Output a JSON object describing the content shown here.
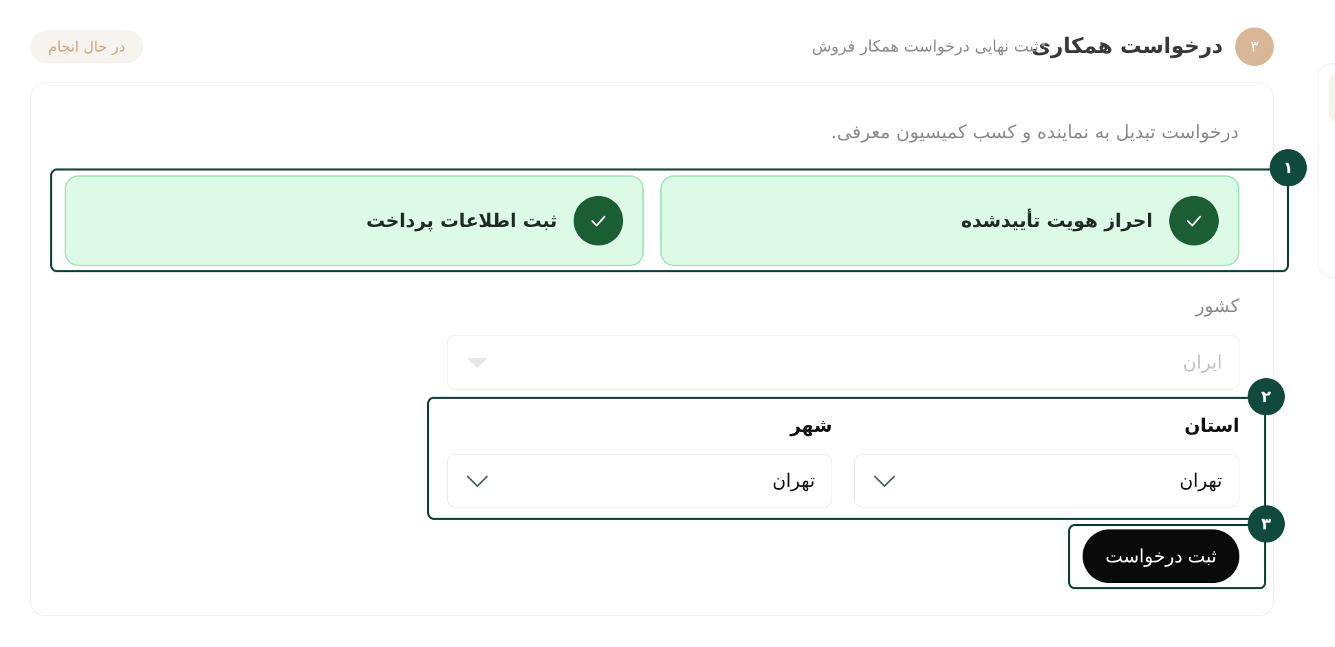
{
  "header": {
    "step_number": "۳",
    "title": "درخواست همکاری",
    "subtitle": "ثبت نهایی درخواست همکار فروش",
    "status": "در حال انجام"
  },
  "intro_text": "درخواست تبدیل به نماینده و کسب کمیسیون معرفی.",
  "annotations": {
    "badge_1": "۱",
    "badge_2": "۲",
    "badge_3": "۳"
  },
  "requirements": [
    {
      "label": "احراز هویت تأییدشده",
      "icon": "check-icon",
      "status": "done"
    },
    {
      "label": "ثبت اطلاعات پرداخت",
      "icon": "check-icon",
      "status": "done"
    }
  ],
  "form": {
    "country": {
      "label": "کشور",
      "value": "ایران",
      "disabled": true
    },
    "province": {
      "label": "استان",
      "value": "تهران"
    },
    "city": {
      "label": "شهر",
      "value": "تهران"
    },
    "submit_label": "ثبت درخواست"
  },
  "colors": {
    "accent_dark_green": "#0f4a3c",
    "success_bg": "#dcfae6",
    "success_border": "#9ae6b4",
    "check_green": "#1b5e34",
    "step_tan": "#d9b796",
    "status_text": "#c9a782",
    "button_black": "#0a0a0a"
  }
}
